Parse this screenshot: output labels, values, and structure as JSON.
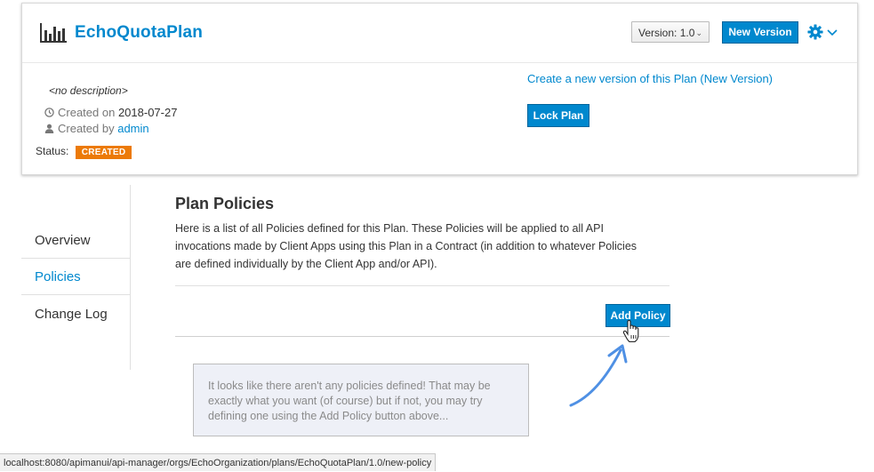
{
  "header": {
    "title": "EchoQuotaPlan",
    "version_select": "Version: 1.0",
    "new_version_button": "New Version"
  },
  "details": {
    "description": "<no description>",
    "created_on_label": "Created on",
    "created_on_value": "2018-07-27",
    "created_by_label": "Created by",
    "created_by_value": "admin",
    "status_label": "Status:",
    "status_badge": "CREATED",
    "create_version_link": "Create a new version of this Plan (New Version)",
    "lock_plan_button": "Lock Plan"
  },
  "sidenav": {
    "items": [
      {
        "label": "Overview"
      },
      {
        "label": "Policies"
      },
      {
        "label": "Change Log"
      }
    ]
  },
  "policies": {
    "title": "Plan Policies",
    "description": "Here is a list of all Policies defined for this Plan. These Policies will be applied to all API invocations made by Client Apps using this Plan in a Contract (in addition to whatever Policies are defined individually by the Client App and/or API).",
    "add_policy_button": "Add Policy",
    "empty_message": "It looks like there aren't any policies defined! That may be exactly what you want (of course) but if not, you may try defining one using the Add Policy button above..."
  },
  "status_bar": {
    "url": "localhost:8080/apimanui/api-manager/orgs/EchoOrganization/plans/EchoQuotaPlan/1.0/new-policy"
  },
  "colors": {
    "accent": "#0088ce",
    "status_created": "#ec7a08"
  },
  "icons": [
    "bar-chart-icon",
    "gear-icon",
    "chevron-down-icon",
    "clock-icon",
    "user-icon",
    "hand-cursor-icon",
    "arrow-icon"
  ]
}
